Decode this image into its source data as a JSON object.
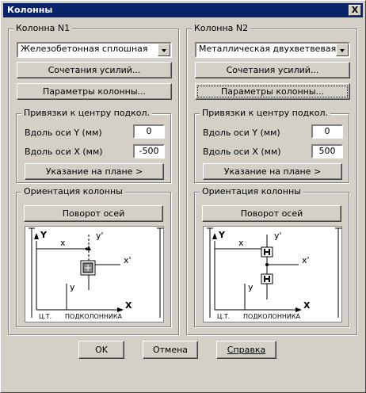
{
  "window": {
    "title": "Колонны",
    "close_label": "X"
  },
  "column1": {
    "group_label": "Колонна N1",
    "type_value": "Железобетонная сплошная",
    "combos_button": "Сочетания усилий...",
    "params_button": "Параметры колонны...",
    "anchors_group": "Привязки к центру подкол.",
    "along_y_label": "Вдоль оси Y (мм)",
    "along_y_value": "0",
    "along_x_label": "Вдоль оси X (мм)",
    "along_x_value": "-500",
    "plan_button": "Указание на плане >",
    "orient_group": "Ориентация колонны",
    "rotate_button": "Поворот осей",
    "diagram": {
      "y_axis": "Y",
      "y_prime": "y'",
      "x_small": "x",
      "x_prime": "x'",
      "y_small": "y",
      "x_axis": "X",
      "ct_label": "Ц.Т.",
      "sub_label": "ПОДКОЛОННИКА"
    }
  },
  "column2": {
    "group_label": "Колонна N2",
    "type_value": "Металлическая двухветвевая",
    "combos_button": "Сочетания усилий...",
    "params_button": "Параметры колонны...",
    "anchors_group": "Привязки к центру подкол.",
    "along_y_label": "Вдоль оси Y (мм)",
    "along_y_value": "0",
    "along_x_label": "Вдоль оси X (мм)",
    "along_x_value": "500",
    "plan_button": "Указание на плане >",
    "orient_group": "Ориентация колонны",
    "rotate_button": "Поворот осей",
    "diagram": {
      "y_axis": "Y",
      "y_prime": "y'",
      "x_small": "x",
      "x_prime": "x'",
      "y_small": "y",
      "x_axis": "X",
      "ct_label": "Ц.Т.",
      "sub_label": "ПОДКОЛОННИКА"
    }
  },
  "footer": {
    "ok": "OK",
    "cancel": "Отмена",
    "help": "Справка"
  }
}
